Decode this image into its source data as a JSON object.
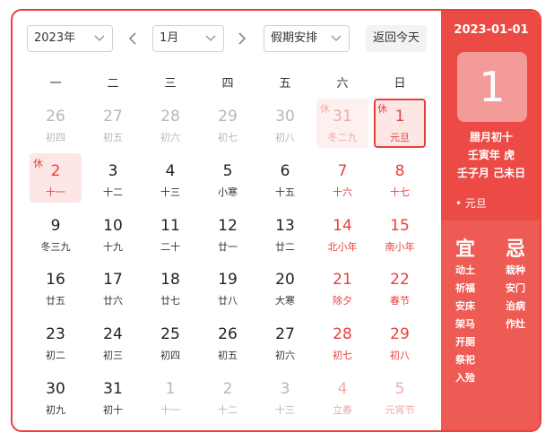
{
  "toolbar": {
    "year": "2023年",
    "month": "1月",
    "holiday": "假期安排",
    "today": "返回今天"
  },
  "weekdays": [
    "一",
    "二",
    "三",
    "四",
    "五",
    "六",
    "日"
  ],
  "weeks": [
    [
      {
        "d": "26",
        "l": "初四",
        "outside": true
      },
      {
        "d": "27",
        "l": "初五",
        "outside": true
      },
      {
        "d": "28",
        "l": "初六",
        "outside": true
      },
      {
        "d": "29",
        "l": "初七",
        "outside": true
      },
      {
        "d": "30",
        "l": "初八",
        "outside": true
      },
      {
        "d": "31",
        "l": "冬二九",
        "outside": true,
        "red": true,
        "tag": "休",
        "bg": "rest-faint"
      },
      {
        "d": "1",
        "l": "元旦",
        "red": true,
        "tag": "休",
        "bg": "selected"
      }
    ],
    [
      {
        "d": "2",
        "l": "十一",
        "red": true,
        "tag": "休",
        "bg": "rest"
      },
      {
        "d": "3",
        "l": "十二"
      },
      {
        "d": "4",
        "l": "十三"
      },
      {
        "d": "5",
        "l": "小寒"
      },
      {
        "d": "6",
        "l": "十五"
      },
      {
        "d": "7",
        "l": "十六",
        "red": true
      },
      {
        "d": "8",
        "l": "十七",
        "red": true
      }
    ],
    [
      {
        "d": "9",
        "l": "冬三九"
      },
      {
        "d": "10",
        "l": "十九"
      },
      {
        "d": "11",
        "l": "二十"
      },
      {
        "d": "12",
        "l": "廿一"
      },
      {
        "d": "13",
        "l": "廿二"
      },
      {
        "d": "14",
        "l": "北小年",
        "red": true
      },
      {
        "d": "15",
        "l": "南小年",
        "red": true
      }
    ],
    [
      {
        "d": "16",
        "l": "廿五"
      },
      {
        "d": "17",
        "l": "廿六"
      },
      {
        "d": "18",
        "l": "廿七"
      },
      {
        "d": "19",
        "l": "廿八"
      },
      {
        "d": "20",
        "l": "大寒"
      },
      {
        "d": "21",
        "l": "除夕",
        "red": true
      },
      {
        "d": "22",
        "l": "春节",
        "red": true
      }
    ],
    [
      {
        "d": "23",
        "l": "初二"
      },
      {
        "d": "24",
        "l": "初三"
      },
      {
        "d": "25",
        "l": "初四"
      },
      {
        "d": "26",
        "l": "初五"
      },
      {
        "d": "27",
        "l": "初六"
      },
      {
        "d": "28",
        "l": "初七",
        "red": true
      },
      {
        "d": "29",
        "l": "初八",
        "red": true
      }
    ],
    [
      {
        "d": "30",
        "l": "初九"
      },
      {
        "d": "31",
        "l": "初十"
      },
      {
        "d": "1",
        "l": "十一",
        "outside": true
      },
      {
        "d": "2",
        "l": "十二",
        "outside": true
      },
      {
        "d": "3",
        "l": "十三",
        "outside": true
      },
      {
        "d": "4",
        "l": "立春",
        "outside": true,
        "red": true
      },
      {
        "d": "5",
        "l": "元宵节",
        "outside": true,
        "red": true
      }
    ]
  ],
  "panel": {
    "date": "2023-01-01",
    "day": "1",
    "lunar": "腊月初十",
    "year_gz": "壬寅年 虎",
    "month_day_gz": "壬子月 己未日",
    "festival": "• 元旦",
    "yi_title": "宜",
    "ji_title": "忌",
    "yi": [
      "动土",
      "祈福",
      "安床",
      "架马",
      "开厕",
      "祭祀",
      "入殓"
    ],
    "ji": [
      "栽种",
      "安门",
      "治病",
      "作灶"
    ]
  },
  "colors": {
    "accent": "#e8413d",
    "panel": "#ec4a45",
    "panel_bottom": "#ee5b55"
  }
}
